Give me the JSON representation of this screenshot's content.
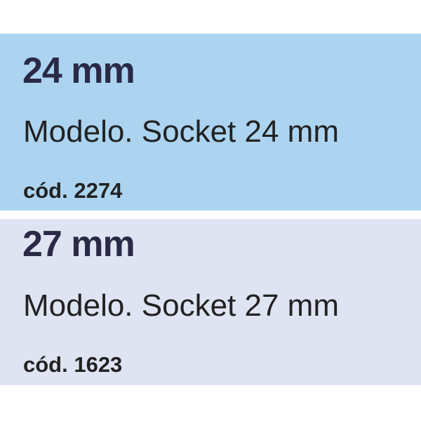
{
  "colors": {
    "page_background": "#ffffff",
    "card_1_background": "#acd4f1",
    "card_2_background": "#dfe4f2",
    "title_text": "#2a2a46",
    "body_text": "#222222"
  },
  "products": [
    {
      "size": "24 mm",
      "model": "Modelo. Socket 24 mm",
      "code": "cód. 2274"
    },
    {
      "size": "27 mm",
      "model": "Modelo. Socket 27 mm",
      "code": "cód. 1623"
    }
  ]
}
